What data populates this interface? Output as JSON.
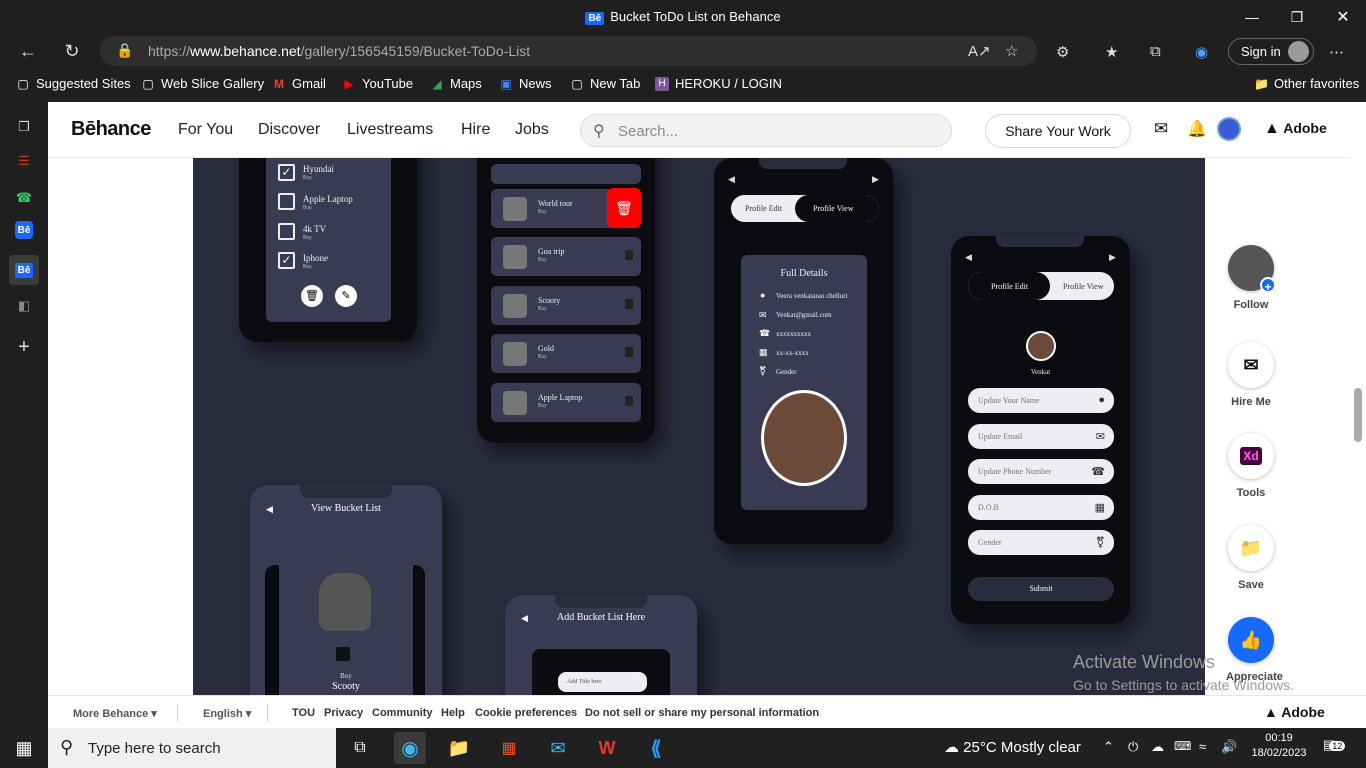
{
  "browser": {
    "tab_title": "Bucket ToDo List on Behance",
    "tab_badge": "Bē",
    "url_prefix": "https://",
    "url_host": "www.behance.net",
    "url_path": "/gallery/156545159/Bucket-ToDo-List",
    "signin_label": "Sign in",
    "bookmarks": [
      "Suggested Sites",
      "Web Slice Gallery",
      "Gmail",
      "YouTube",
      "Maps",
      "News",
      "New Tab",
      "HEROKU / LOGIN"
    ],
    "other_favorites": "Other favorites"
  },
  "behance": {
    "logo": "Bēhance",
    "nav": [
      "For You",
      "Discover",
      "Livestreams",
      "Hire",
      "Jobs"
    ],
    "search_placeholder": "Search...",
    "share_label": "Share Your Work",
    "adobe_label": "Adobe"
  },
  "artwork": {
    "checklist": [
      {
        "title": "Hyundai",
        "sub": "Buy",
        "checked": true
      },
      {
        "title": "Apple Laptop",
        "sub": "Buy",
        "checked": false
      },
      {
        "title": "4k TV",
        "sub": "Buy",
        "checked": false
      },
      {
        "title": "Iphone",
        "sub": "Buy",
        "checked": true
      }
    ],
    "bucket_rows": [
      {
        "title": "World tour",
        "sub": "Buy"
      },
      {
        "title": "Goa trip",
        "sub": "Buy"
      },
      {
        "title": "Scooty",
        "sub": "Buy"
      },
      {
        "title": "Gold",
        "sub": "Buy"
      },
      {
        "title": "Apple Laptop",
        "sub": "Buy"
      }
    ],
    "profile_view": {
      "toggle_left": "Profile Edit",
      "toggle_right": "Profile View",
      "heading": "Full Details",
      "details": [
        "Veera venkatarao chelluri",
        "Venkat@gmail.com",
        "xxxxxxxxxx",
        "xx-xx-xxxx",
        "Gender"
      ]
    },
    "profile_edit": {
      "toggle_left": "Profile Edit",
      "toggle_right": "Profile View",
      "name": "Venkat",
      "fields": [
        "Update Your Name",
        "Update Email",
        "Update Phone Number",
        "D.O.B",
        "Gender"
      ],
      "submit": "Submit"
    },
    "view_bucket": {
      "title": "View Bucket List",
      "item_sub": "Buy",
      "item_title": "Scooty"
    },
    "add_bucket": {
      "title": "Add Bucket List Here",
      "input_placeholder": "Add Title here"
    }
  },
  "rail": {
    "follow": "Follow",
    "hire": "Hire Me",
    "tools": "Tools",
    "tools_badge": "Xd",
    "save": "Save",
    "appreciate": "Appreciate"
  },
  "watermark": {
    "line1": "Activate Windows",
    "line2": "Go to Settings to activate Windows."
  },
  "footer": {
    "more": "More Behance ▾",
    "lang": "English ▾",
    "links": [
      "TOU",
      "Privacy",
      "Community",
      "Help",
      "Cookie preferences",
      "Do not sell or share my personal information"
    ],
    "adobe": "Adobe"
  },
  "taskbar": {
    "search_placeholder": "Type here to search",
    "weather": "25°C  Mostly clear",
    "time": "00:19",
    "date": "18/02/2023",
    "notif_count": "12"
  }
}
